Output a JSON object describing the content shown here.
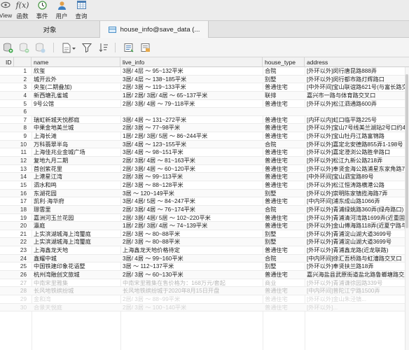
{
  "toolbar": {
    "items": [
      {
        "label": "View",
        "icon": "eye-icon"
      },
      {
        "label": "函数",
        "icon": "function-icon",
        "glyph": "f(x)"
      },
      {
        "label": "事件",
        "icon": "clock-icon"
      },
      {
        "label": "用户",
        "icon": "user-icon"
      },
      {
        "label": "查询",
        "icon": "calendar-grid-icon"
      }
    ]
  },
  "tabs": [
    {
      "label": "对象",
      "active": false
    },
    {
      "label": "house_info@save_data (...",
      "active": true
    }
  ],
  "columns": [
    "ID",
    "name",
    "live_info",
    "house_type",
    "address"
  ],
  "rows": [
    {
      "id": "1",
      "name": "欣玺",
      "live_info": "3居/ 4层 ～ 95~132平米",
      "house_type": "合院",
      "address": "[外环以外]闵行唐昆路888弄"
    },
    {
      "id": "2",
      "name": "城开云外",
      "live_info": "3居/ 4层 ～ 138~185平米",
      "house_type": "别墅",
      "address": "[外环以外]闵行都市路灯辉路口"
    },
    {
      "id": "3",
      "name": "央玺(二期叠加)",
      "live_info": "2居/ 3居 ～ 119~133平米",
      "house_type": "普通住宅",
      "address": "[中外环间]宝山联谊路621号(与富长路交叉"
    },
    {
      "id": "4",
      "name": "新西塘孔雀城",
      "live_info": "1居/ 2居/ 3居/ 4居 ～ 65~137平米",
      "house_type": "联排",
      "address": "嘉兴市一路与体育路交叉口"
    },
    {
      "id": "5",
      "name": "9号公馆",
      "live_info": "2居/ 3居/ 4居 ～ 79~118平米",
      "house_type": "普通住宅",
      "address": "[外环以外]松江泗通路600弄"
    },
    {
      "id": "6",
      "name": "",
      "live_info": "",
      "house_type": "",
      "address": ""
    },
    {
      "id": "7",
      "name": "瑞虹新城天悦郡庭",
      "live_info": "3居/ 4居 ～ 131~272平米",
      "house_type": "普通住宅",
      "address": "[内环以内]虹口临平路225号"
    },
    {
      "id": "8",
      "name": "中果金地美兰城",
      "live_info": "2居/ 3居 ～ 77~98平米",
      "house_type": "普通住宅",
      "address": "[外环以外]宝山7号线美兰湖站2号口约40"
    },
    {
      "id": "9",
      "name": "上海长滩",
      "live_info": "1居/ 2居/ 3居/ 5居 ～ 86~244平米",
      "house_type": "普通住宅",
      "address": "[外环以外]宝山牡丹江路富锦路"
    },
    {
      "id": "10",
      "name": "万科翡翠半岛",
      "live_info": "3居/ 4居 ～ 123~155平米",
      "house_type": "合院",
      "address": "[外环以外]嘉定北安德路855弄1-198号"
    },
    {
      "id": "11",
      "name": "上海佳兆业金城广场",
      "live_info": "3居/ 4居 ～ 98~151平米",
      "house_type": "普通住宅",
      "address": "[外环以外]嘉定澄浏公路胜辛路口"
    },
    {
      "id": "12",
      "name": "复地九月二期",
      "live_info": "2居/ 3居/ 4居 ～ 81~163平米",
      "house_type": "普通住宅",
      "address": "[外环以外]松江九新公路218弄"
    },
    {
      "id": "13",
      "name": "首创紫花里",
      "live_info": "2居/ 3居/ 4居 ～ 60~120平米",
      "house_type": "普通住宅",
      "address": "[外环以外]奉贤金海公路浦星东家角路77弄1-"
    },
    {
      "id": "14",
      "name": "上港星江湾",
      "live_info": "2居/ 3居 ～ 99~113平米",
      "house_type": "普通住宅",
      "address": "[中外环间]宝山泗宝路89号"
    },
    {
      "id": "15",
      "name": "泗水和鸣",
      "live_info": "2居/ 3居 ～ 88~128平米",
      "house_type": "普通住宅",
      "address": "[外环以外]松江恒涛路横港公路"
    },
    {
      "id": "16",
      "name": "东湖花园",
      "live_info": "3居 ～ 120~149平米",
      "house_type": "别墅",
      "address": "[外环以外]崇明陈家镇揽海路7弄"
    },
    {
      "id": "17",
      "name": "凯利·海华府",
      "live_info": "3居/ 4居/ 5居 ～ 84~247平米",
      "house_type": "普通住宅",
      "address": "[中内环间]浦东成山路1066弄"
    },
    {
      "id": "18",
      "name": "璟雲里",
      "live_info": "2居/ 3居/ 4居 ～ 76~174平米",
      "house_type": "合院",
      "address": "[外环以外]青浦绿姚路360弄(绿舟路口)"
    },
    {
      "id": "19",
      "name": "嘉洲河玉兰花园",
      "live_info": "2居/ 3居/ 4居/ 5居 ～ 102~220平米",
      "house_type": "普通住宅",
      "address": "[外环以外]青浦清河湾路1699弄(近重固路"
    },
    {
      "id": "20",
      "name": "瀛庭",
      "live_info": "1居/ 2居/ 3居/ 4居 ～ 74~139平米",
      "house_type": "普通住宅",
      "address": "[外环以外]金山傅海路118弄(近夏宁路与"
    },
    {
      "id": "21",
      "name": "上实滨湖城海上湾璽庭",
      "live_info": "2居/ 3居 ～ 80~88平米",
      "house_type": "别墅",
      "address": "[外环以外]青浦淀山湖大道3699号"
    },
    {
      "id": "22",
      "name": "上实滨湖城海上湾璽庭",
      "live_info": "2居/ 3居 ～ 80~88平米",
      "house_type": "别墅",
      "address": "[外环以外]青浦淀山湖大道3699号"
    },
    {
      "id": "23",
      "name": "上海鑫龙天地",
      "live_info": "上海鑫龙天地价格待定",
      "house_type": "普通住宅",
      "address": "[外环以外]青浦鑫龙路(近龙联路)"
    },
    {
      "id": "24",
      "name": "鑫耀中城",
      "live_info": "3居/ 4居 ～ 99~160平米",
      "house_type": "合院",
      "address": "[中内环间]徐汇吾桥路与虹漕路交叉口"
    },
    {
      "id": "25",
      "name": "中国铁建印象花语墅",
      "live_info": "3居 ～ 112~137平米",
      "house_type": "别墅",
      "address": "[外环以外]奉贤扶兰路18弄"
    },
    {
      "id": "26",
      "name": "杭州湾融创文旅城",
      "live_info": "2居/ 3居 ～ 60~130平米",
      "house_type": "普通住宅",
      "address": "嘉兴海盐县武原街道盐北路鲁螂塘路交叉"
    },
    {
      "id": "27",
      "name": "中南宋里雅集",
      "live_info": "中南宋里雅集在售价格为：168万元/套起",
      "house_type": "商业",
      "address": "[外环以外]青浦谦徐园路339号",
      "fade": 1
    },
    {
      "id": "28",
      "name": "长风地铁缤纷城",
      "live_info": "长风地铁缤纷城于2020年8月15日开盘",
      "house_type": "普通住宅",
      "address": "[中内环间]普陀江宁路1500弄",
      "fade": 1
    },
    {
      "id": "29",
      "name": "金和湾",
      "live_info": "2居/ 3居 ～ 88~99平米",
      "house_type": "普通住宅",
      "address": "[外环以外]金山朱泾镇...",
      "fade": 2
    },
    {
      "id": "30",
      "name": "合景天悦庭",
      "live_info": "2居/ 3居 ～ 100~140平米",
      "house_type": "普通住宅",
      "address": "[外环以外]...",
      "fade": 2
    }
  ],
  "colors": {
    "accent": "#4a90c8",
    "toolbar_bg": "#ececec",
    "tab_bg": "#e4e4e4",
    "header_bg": "#f2f2f2"
  }
}
